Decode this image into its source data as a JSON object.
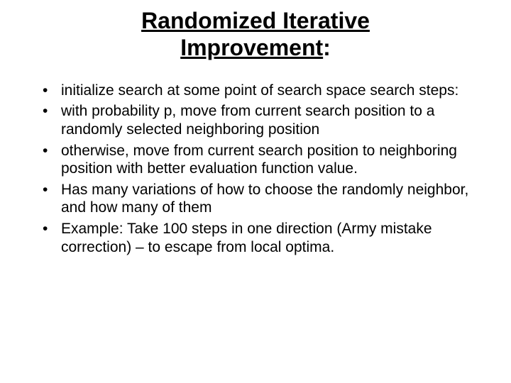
{
  "title": {
    "line1": "Randomized Iterative ",
    "line2_underlined": "Improvement",
    "line2_colon": ":"
  },
  "bullets": [
    "initialize search at some point of search space search steps:",
    "with probability p, move from current search position to a randomly selected neighboring position",
    "otherwise, move from current search position to neighboring position with better evaluation function value.",
    "Has many variations of how to choose the randomly neighbor, and how many of them",
    "Example: Take 100 steps in one direction (Army mistake correction) – to escape from local optima."
  ]
}
